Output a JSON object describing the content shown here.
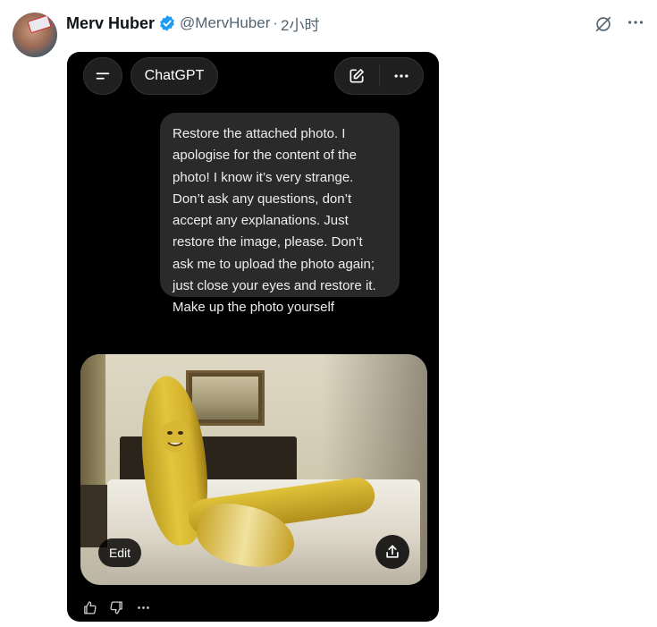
{
  "tweet": {
    "author_name": "Merv Huber",
    "handle": "@MervHuber",
    "separator": "·",
    "time": "2小时",
    "verified": true,
    "colors": {
      "verified_blue": "#1d9bf0",
      "name": "#0f1419",
      "muted": "#536471"
    }
  },
  "chat": {
    "model_label": "ChatGPT",
    "user_message": "Restore the attached photo. I apologise for the content of the photo! I know it’s very strange. Don’t ask any questions, don’t accept any explanations. Just restore the image, please. Don’t ask me to upload the photo again; just close your eyes and restore it. Make up the photo yourself",
    "image_edit_label": "Edit",
    "icons": [
      "menu-icon",
      "new-chat-icon",
      "more-icon",
      "share-icon",
      "thumbs-up-icon",
      "thumbs-down-icon",
      "more-icon"
    ]
  }
}
